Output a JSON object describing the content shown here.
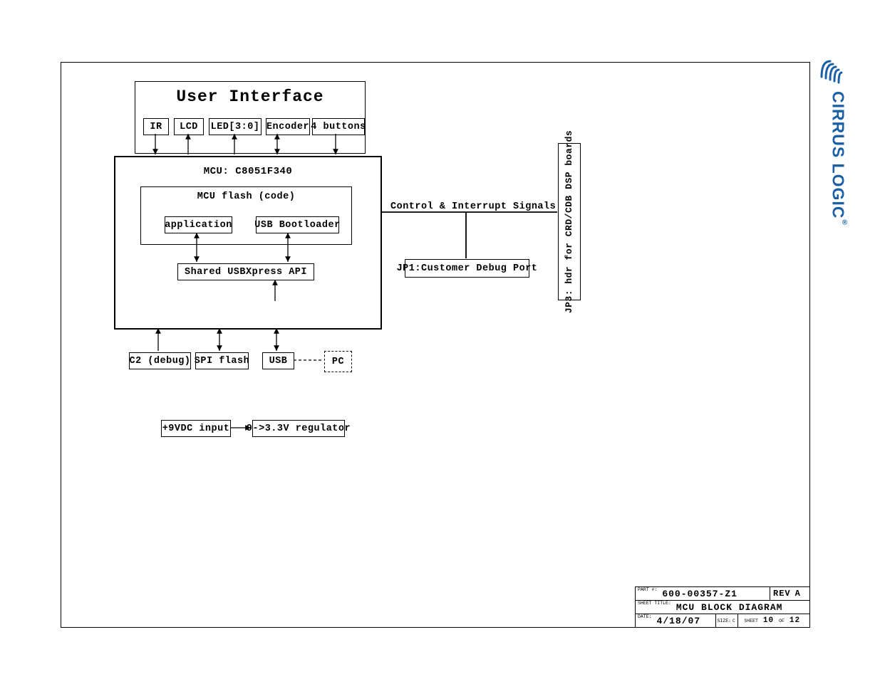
{
  "ui_title": "User Interface",
  "ui_blocks": {
    "ir": "IR",
    "lcd": "LCD",
    "led": "LED[3:0]",
    "encoder": "Encoder",
    "buttons": "4 buttons"
  },
  "mcu_title": "MCU: C8051F340",
  "flash_title": "MCU flash (code)",
  "flash_app": "application",
  "flash_boot": "USB Bootloader",
  "shared_api": "Shared USBXpress API",
  "bottom": {
    "c2": "C2 (debug)",
    "spi": "SPI flash",
    "usb": "USB",
    "pc": "PC"
  },
  "power": {
    "vin": "+9VDC input",
    "reg": "9->3.3V regulator"
  },
  "signals_label": "Control & Interrupt Signals",
  "jp1": "JP1:Customer Debug Port",
  "jp3": "JP3: hdr for CRD/CDB DSP boards",
  "logo": "CIRRUS LOGIC",
  "titleblock": {
    "part_no_lab": "PART #:",
    "part_no": "600-00357-Z1",
    "rev_lab": "REV",
    "rev": "A",
    "sheet_title_lab": "SHEET TITLE:",
    "sheet_title": "MCU BLOCK DIAGRAM",
    "date_lab": "DATE:",
    "date": "4/18/07",
    "size_lab": "SIZE:",
    "size": "C",
    "sheet_lab": "SHEET",
    "sheet_cur": "10",
    "sheet_of": "OF",
    "sheet_tot": "12"
  }
}
